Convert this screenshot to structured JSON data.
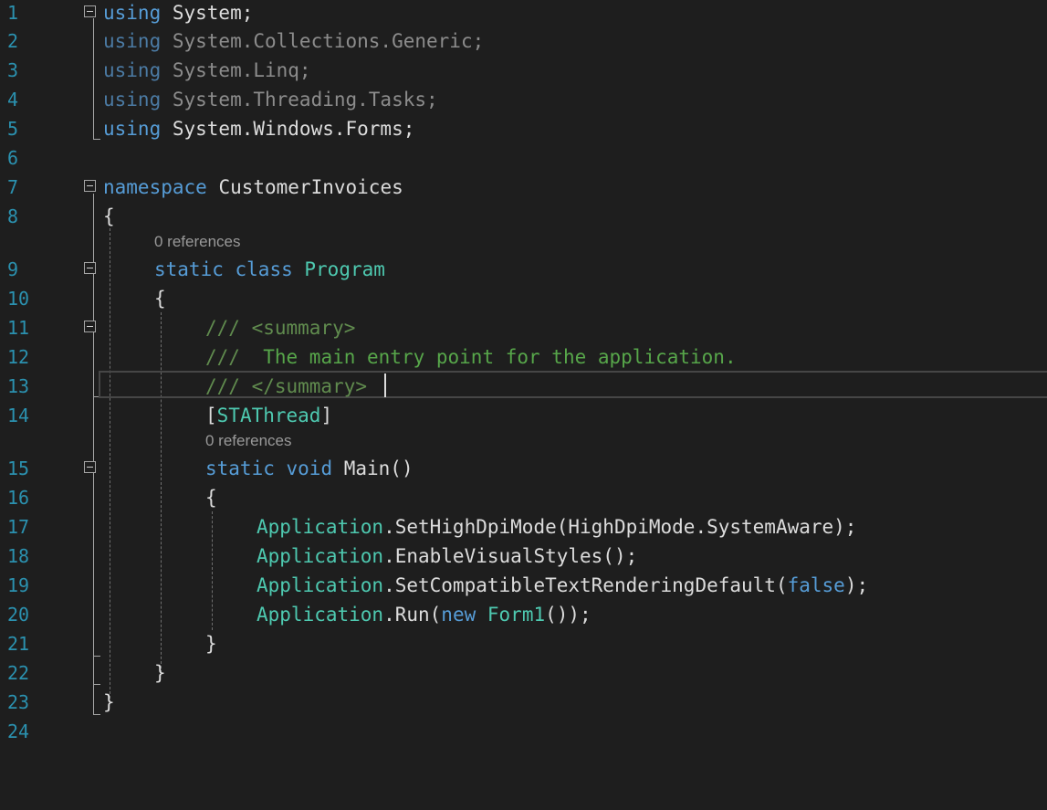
{
  "colors": {
    "background": "#1e1e1e",
    "line_number": "#2b91af",
    "keyword": "#569cd6",
    "type": "#4ec9b0",
    "comment": "#57a64a",
    "xml_doc": "#608b4e",
    "plain": "#dcdcdc",
    "unused": "#8c8c8c",
    "codelens": "#999999"
  },
  "editor": {
    "current_line": 13,
    "lines": [
      {
        "n": "1",
        "tokens": [
          {
            "t": "using",
            "k": "keyword"
          },
          {
            "t": " System;",
            "k": "plain"
          }
        ]
      },
      {
        "n": "2",
        "tokens": [
          {
            "t": "using",
            "k": "unused_keyword"
          },
          {
            "t": " System.Collections.Generic;",
            "k": "unused"
          }
        ]
      },
      {
        "n": "3",
        "tokens": [
          {
            "t": "using",
            "k": "unused_keyword"
          },
          {
            "t": " System.Linq;",
            "k": "unused"
          }
        ]
      },
      {
        "n": "4",
        "tokens": [
          {
            "t": "using",
            "k": "unused_keyword"
          },
          {
            "t": " System.Threading.Tasks;",
            "k": "unused"
          }
        ]
      },
      {
        "n": "5",
        "tokens": [
          {
            "t": "using",
            "k": "keyword"
          },
          {
            "t": " System.Windows.Forms;",
            "k": "plain"
          }
        ]
      },
      {
        "n": "6",
        "tokens": []
      },
      {
        "n": "7",
        "tokens": [
          {
            "t": "namespace",
            "k": "keyword"
          },
          {
            "t": " CustomerInvoices",
            "k": "plain"
          }
        ]
      },
      {
        "n": "8",
        "tokens": [
          {
            "t": "{",
            "k": "plain"
          }
        ]
      },
      {
        "n": "9",
        "tokens": [
          {
            "t": "static",
            "k": "keyword"
          },
          {
            "t": " ",
            "k": "plain"
          },
          {
            "t": "class",
            "k": "keyword"
          },
          {
            "t": " ",
            "k": "plain"
          },
          {
            "t": "Program",
            "k": "type"
          }
        ]
      },
      {
        "n": "10",
        "tokens": [
          {
            "t": "{",
            "k": "plain"
          }
        ]
      },
      {
        "n": "11",
        "tokens": [
          {
            "t": "/// <summary>",
            "k": "xml_doc"
          }
        ]
      },
      {
        "n": "12",
        "tokens": [
          {
            "t": "///",
            "k": "xml_doc"
          },
          {
            "t": "  The main entry point for the application.",
            "k": "comment"
          }
        ]
      },
      {
        "n": "13",
        "tokens": [
          {
            "t": "/// </summary>",
            "k": "xml_doc"
          }
        ]
      },
      {
        "n": "14",
        "tokens": [
          {
            "t": "[",
            "k": "plain"
          },
          {
            "t": "STAThread",
            "k": "type"
          },
          {
            "t": "]",
            "k": "plain"
          }
        ]
      },
      {
        "n": "15",
        "tokens": [
          {
            "t": "static",
            "k": "keyword"
          },
          {
            "t": " ",
            "k": "plain"
          },
          {
            "t": "void",
            "k": "keyword"
          },
          {
            "t": " Main()",
            "k": "plain"
          }
        ]
      },
      {
        "n": "16",
        "tokens": [
          {
            "t": "{",
            "k": "plain"
          }
        ]
      },
      {
        "n": "17",
        "tokens": [
          {
            "t": "Application",
            "k": "type"
          },
          {
            "t": ".SetHighDpiMode(HighDpiMode.SystemAware);",
            "k": "plain"
          }
        ]
      },
      {
        "n": "18",
        "tokens": [
          {
            "t": "Application",
            "k": "type"
          },
          {
            "t": ".EnableVisualStyles();",
            "k": "plain"
          }
        ]
      },
      {
        "n": "19",
        "tokens": [
          {
            "t": "Application",
            "k": "type"
          },
          {
            "t": ".SetCompatibleTextRenderingDefault(",
            "k": "plain"
          },
          {
            "t": "false",
            "k": "keyword"
          },
          {
            "t": ");",
            "k": "plain"
          }
        ]
      },
      {
        "n": "20",
        "tokens": [
          {
            "t": "Application",
            "k": "type"
          },
          {
            "t": ".Run(",
            "k": "plain"
          },
          {
            "t": "new",
            "k": "keyword"
          },
          {
            "t": " ",
            "k": "plain"
          },
          {
            "t": "Form1",
            "k": "type"
          },
          {
            "t": "());",
            "k": "plain"
          }
        ]
      },
      {
        "n": "21",
        "tokens": [
          {
            "t": "}",
            "k": "plain"
          }
        ]
      },
      {
        "n": "22",
        "tokens": [
          {
            "t": "}",
            "k": "plain"
          }
        ]
      },
      {
        "n": "23",
        "tokens": [
          {
            "t": "}",
            "k": "plain"
          }
        ]
      },
      {
        "n": "24",
        "tokens": []
      }
    ],
    "codelens": [
      {
        "text": "0 references",
        "before_line": 9
      },
      {
        "text": "0 references",
        "before_line": 15
      }
    ]
  }
}
